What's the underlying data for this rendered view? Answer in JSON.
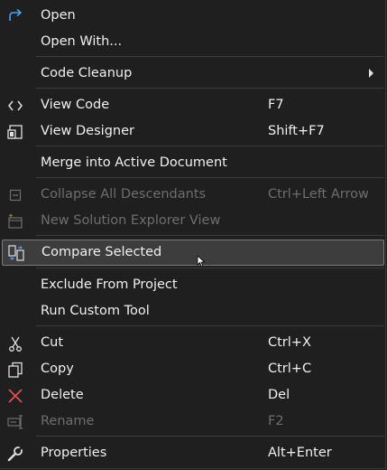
{
  "menu": {
    "open": {
      "label": "Open",
      "icon": "redo-arrow-icon"
    },
    "open_with": {
      "label": "Open With..."
    },
    "code_cleanup": {
      "label": "Code Cleanup",
      "icon": "submenu-arrow-icon"
    },
    "view_code": {
      "label": "View Code",
      "shortcut": "F7",
      "icon": "code-brackets-icon"
    },
    "view_designer": {
      "label": "View Designer",
      "shortcut": "Shift+F7",
      "icon": "designer-icon"
    },
    "merge": {
      "label": "Merge into Active Document"
    },
    "collapse": {
      "label": "Collapse All Descendants",
      "shortcut": "Ctrl+Left Arrow",
      "icon": "collapse-icon",
      "disabled": true
    },
    "new_view": {
      "label": "New Solution Explorer View",
      "icon": "new-window-icon",
      "disabled": true
    },
    "compare": {
      "label": "Compare Selected",
      "icon": "compare-files-icon",
      "selected": true
    },
    "exclude": {
      "label": "Exclude From Project"
    },
    "run_tool": {
      "label": "Run Custom Tool"
    },
    "cut": {
      "label": "Cut",
      "shortcut": "Ctrl+X",
      "icon": "scissors-icon"
    },
    "copy": {
      "label": "Copy",
      "shortcut": "Ctrl+C",
      "icon": "copy-icon"
    },
    "delete": {
      "label": "Delete",
      "shortcut": "Del",
      "icon": "delete-x-icon"
    },
    "rename": {
      "label": "Rename",
      "shortcut": "F2",
      "icon": "rename-icon",
      "disabled": true
    },
    "properties": {
      "label": "Properties",
      "shortcut": "Alt+Enter",
      "icon": "wrench-icon"
    }
  },
  "colors": {
    "background": "#1f1f1f",
    "text": "#f0f0f0",
    "disabled_text": "#6e6e6e",
    "accent_blue": "#4d9ff0",
    "delete_red": "#e8504f",
    "selected_bg": "#3d3d3d"
  }
}
